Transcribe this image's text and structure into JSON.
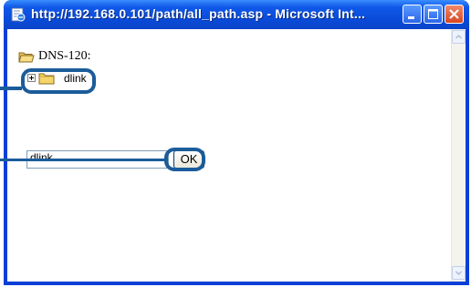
{
  "window": {
    "title": "http://192.168.0.101/path/all_path.asp - Microsoft Int...",
    "icon": "ie-page-icon",
    "controls": {
      "minimize": "minimize-icon",
      "maximize": "maximize-icon",
      "close": "close-icon"
    }
  },
  "tree": {
    "root_label": "DNS-120:",
    "children": [
      {
        "label": "dlink",
        "expandable": true
      }
    ]
  },
  "form": {
    "path_value": "dlink",
    "ok_label": "OK"
  },
  "colors": {
    "titlebar": "#0a4ad8",
    "callout": "#1b5c9a",
    "folder": "#f5d66a"
  }
}
